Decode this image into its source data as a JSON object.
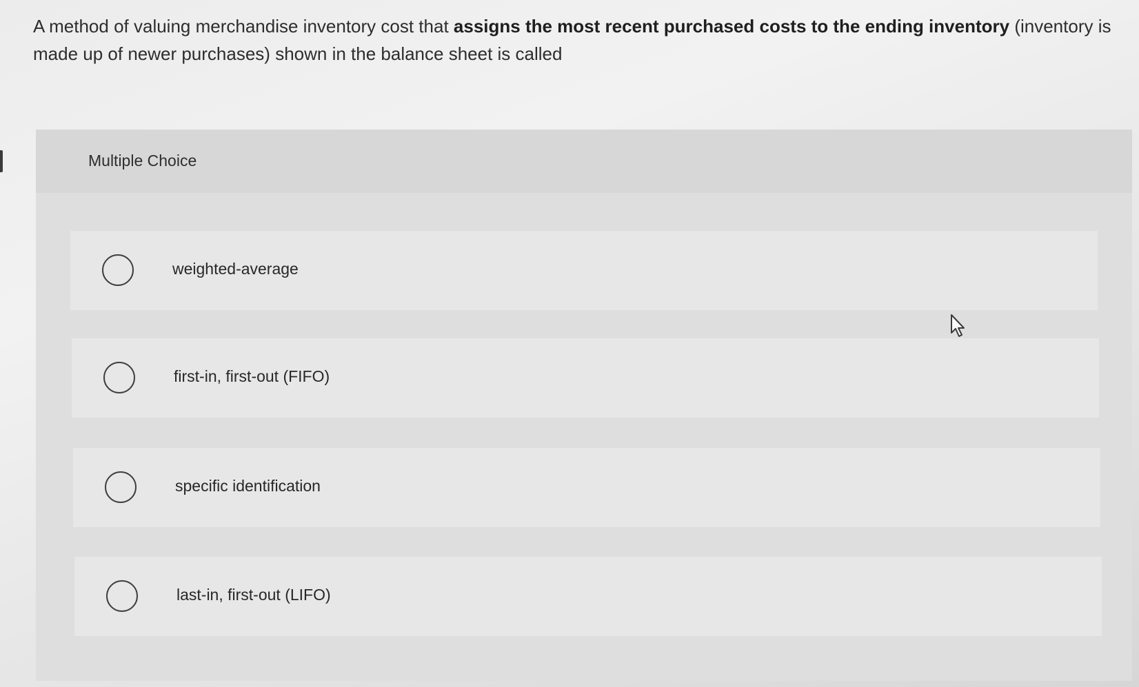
{
  "question": {
    "text_prefix": "A method of valuing merchandise inventory cost that ",
    "text_bold": "assigns the most recent purchased costs to the ending inventory",
    "text_suffix": " (inventory is made up of newer purchases) shown in the balance sheet is called"
  },
  "multiple_choice": {
    "header_label": "Multiple Choice",
    "options": [
      {
        "label": "weighted-average",
        "selected": false
      },
      {
        "label": "first-in, first-out (FIFO)",
        "selected": false
      },
      {
        "label": "specific identification",
        "selected": false
      },
      {
        "label": "last-in, first-out (LIFO)",
        "selected": false
      }
    ]
  },
  "icons": {
    "cursor": "mouse-pointer-icon",
    "radio": "radio-circle-icon"
  }
}
